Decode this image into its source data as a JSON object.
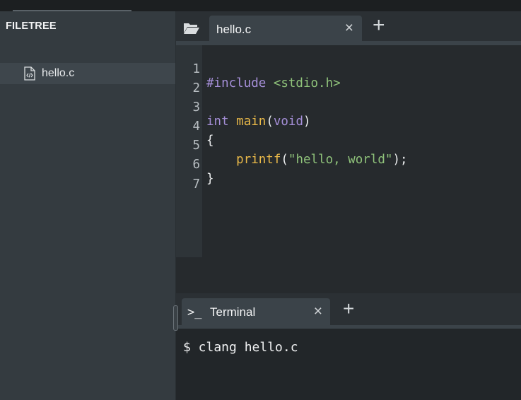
{
  "sidebar": {
    "title": "FILETREE",
    "files": [
      {
        "name": "hello.c",
        "icon": "code-file-icon"
      }
    ]
  },
  "editor": {
    "tabs": [
      {
        "label": "hello.c",
        "close": "×"
      }
    ],
    "add_tab": "+",
    "lines": [
      {
        "n": "1"
      },
      {
        "n": "2"
      },
      {
        "n": "3"
      },
      {
        "n": "4"
      },
      {
        "n": "5"
      },
      {
        "n": "6"
      },
      {
        "n": "7"
      }
    ],
    "code": {
      "l1_a": "#include ",
      "l1_b": "<stdio.h>",
      "l3_a": "int",
      "l3_b": " ",
      "l3_c": "main",
      "l3_d": "(",
      "l3_e": "void",
      "l3_f": ")",
      "l4": "{",
      "l5_indent": "    ",
      "l5_a": "printf",
      "l5_b": "(",
      "l5_c": "\"hello, world\"",
      "l5_d": ");",
      "l6": "}"
    }
  },
  "terminal": {
    "tab_icon": ">_",
    "tab_label": "Terminal",
    "close": "×",
    "add_tab": "+",
    "output": "$ clang hello.c"
  },
  "colors": {
    "keyword": "#a58fd8",
    "string": "#8fc27a",
    "function": "#e9b949",
    "background": "#232729"
  }
}
